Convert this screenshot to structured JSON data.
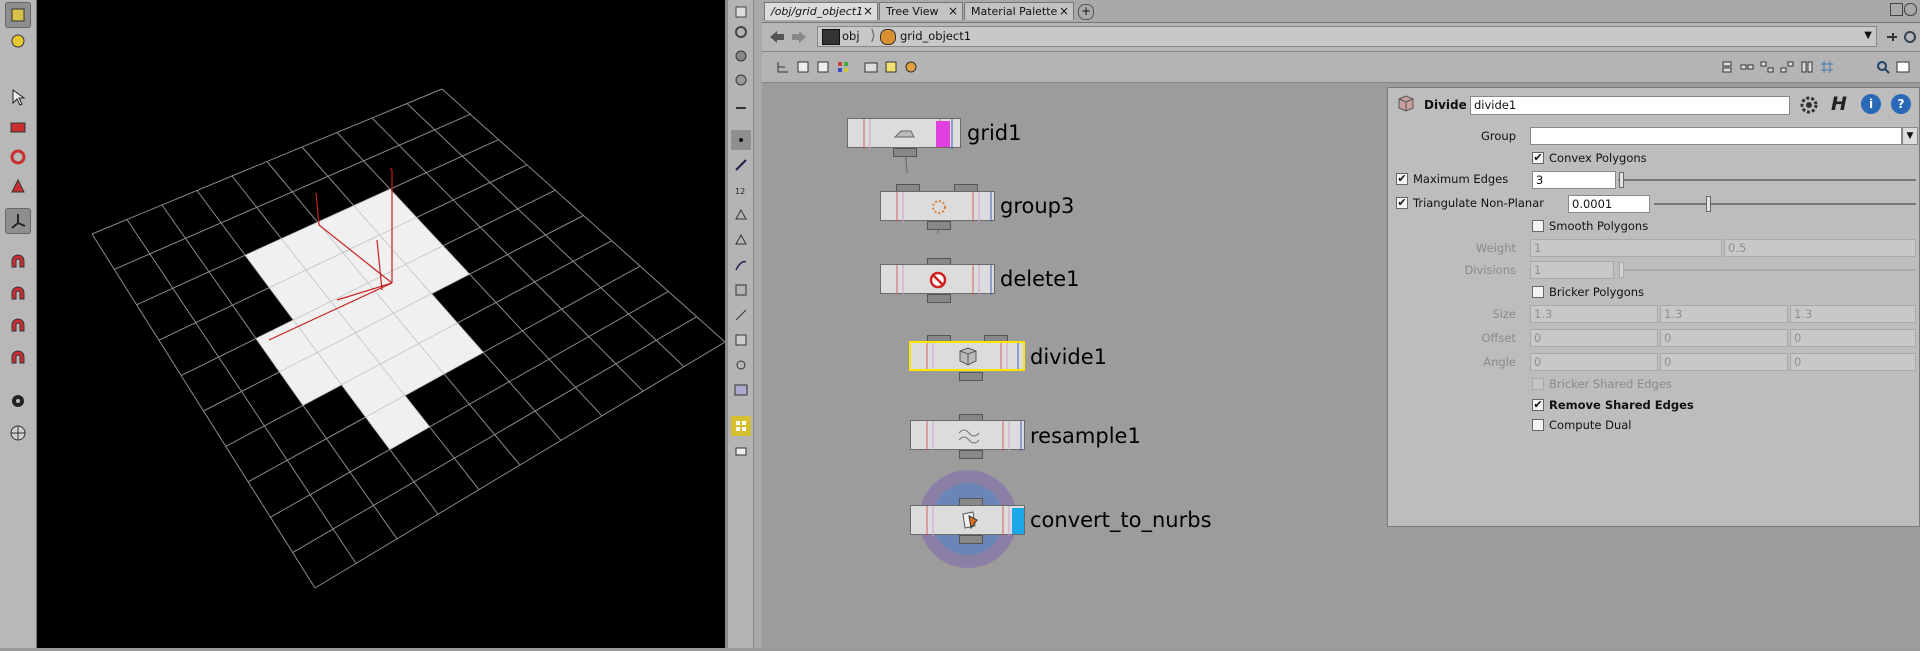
{
  "tabs": [
    {
      "label": "/obj/grid_object1",
      "active": true
    },
    {
      "label": "Tree View",
      "active": false
    },
    {
      "label": "Material Palette",
      "active": false
    }
  ],
  "path": {
    "root": "obj",
    "current": "grid_object1"
  },
  "nodes": [
    {
      "label": "grid1",
      "icon": "grid-icon",
      "display_flag_color": "#e040e0"
    },
    {
      "label": "group3",
      "icon": "group-icon"
    },
    {
      "label": "delete1",
      "icon": "delete-icon"
    },
    {
      "label": "divide1",
      "icon": "divide-icon",
      "selected": true
    },
    {
      "label": "resample1",
      "icon": "resample-icon"
    },
    {
      "label": "convert_to_nurbs",
      "icon": "convert-icon",
      "display_flag_color": "#1aa8e8"
    }
  ],
  "params": {
    "node_type": "Divide",
    "node_name": "divide1",
    "group_label": "Group",
    "group_value": "",
    "convex_polygons": {
      "label": "Convex Polygons",
      "checked": true
    },
    "maximum_edges": {
      "label": "Maximum Edges",
      "checked": true,
      "value": "3"
    },
    "triangulate": {
      "label": "Triangulate Non-Planar",
      "checked": true,
      "value": "0.0001"
    },
    "smooth_polygons": {
      "label": "Smooth Polygons",
      "checked": false
    },
    "weight": {
      "label": "Weight",
      "values": [
        "1",
        "0.5"
      ]
    },
    "divisions": {
      "label": "Divisions",
      "value": "1"
    },
    "bricker_polygons": {
      "label": "Bricker Polygons",
      "checked": false
    },
    "size": {
      "label": "Size",
      "values": [
        "1.3",
        "1.3",
        "1.3"
      ]
    },
    "offset": {
      "label": "Offset",
      "values": [
        "0",
        "0",
        "0"
      ]
    },
    "angle": {
      "label": "Angle",
      "values": [
        "0",
        "0",
        "0"
      ]
    },
    "bricker_shared_edges": {
      "label": "Bricker Shared Edges",
      "checked": false
    },
    "remove_shared_edges": {
      "label": "Remove Shared Edges",
      "checked": true
    },
    "compute_dual": {
      "label": "Compute Dual",
      "checked": false
    }
  },
  "check_glyph": "✔",
  "colors": {
    "selection": "#ffe600",
    "viewport_bg": "#000000",
    "grid_line": "#8a8a8a",
    "polygon": "#f0f0f0",
    "handle": "#cc2222"
  }
}
